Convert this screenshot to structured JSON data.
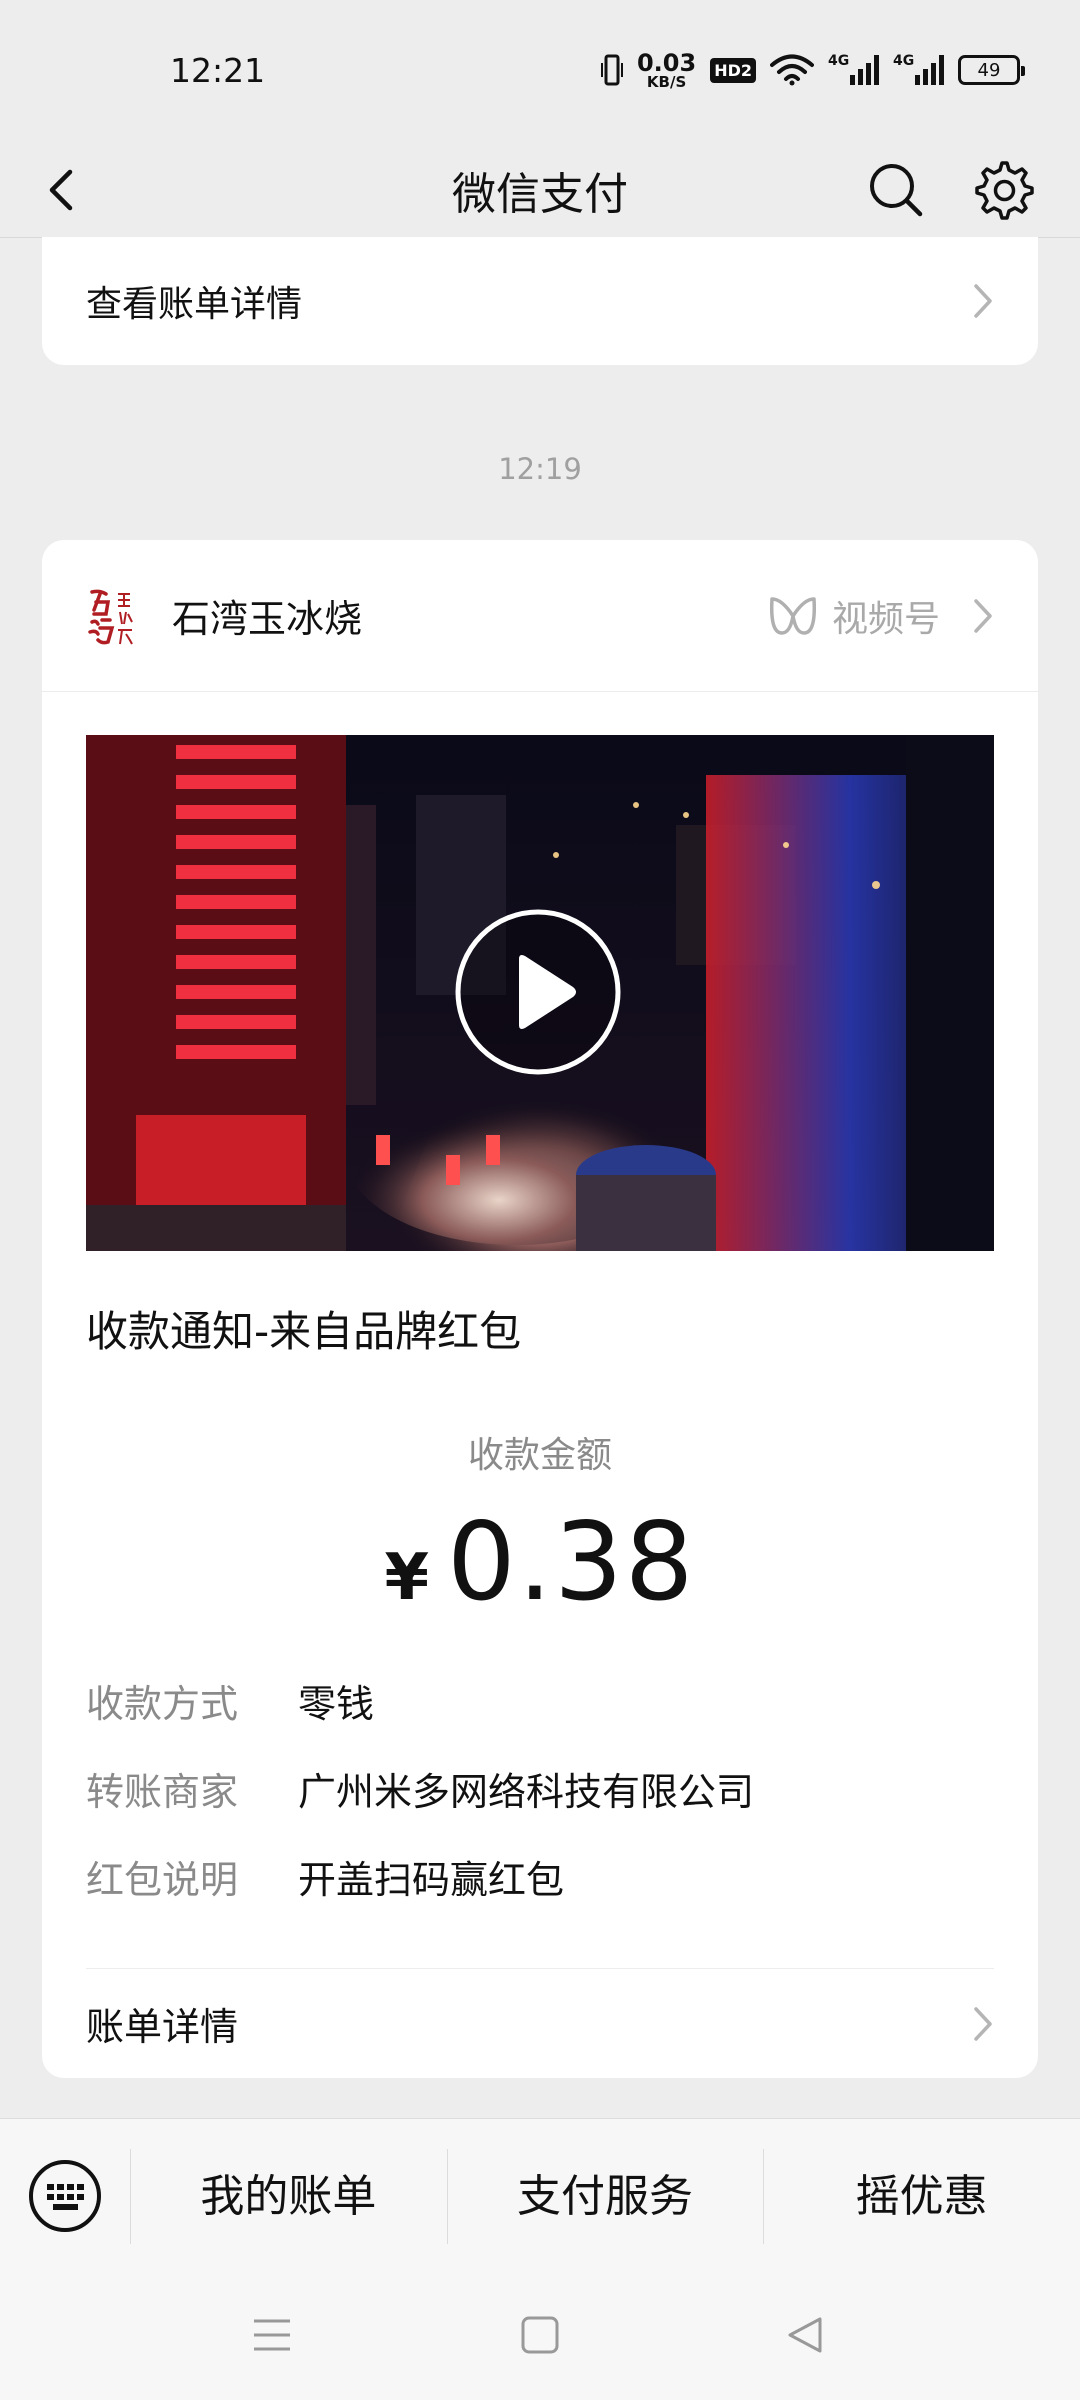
{
  "status_bar": {
    "time": "12:21",
    "net_speed_value": "0.03",
    "net_speed_unit": "KB/S",
    "hd_badge": "HD2",
    "signal_1": "4G",
    "signal_2": "4G",
    "battery": "49"
  },
  "navbar": {
    "title": "微信支付",
    "back_icon": "back-arrow-icon",
    "search_icon": "search-icon",
    "settings_icon": "gear-icon"
  },
  "bill_card": {
    "label": "查看账单详情"
  },
  "timestamp": "12:19",
  "message": {
    "brand_name": "石湾玉冰烧",
    "channel_label": "视频号",
    "title": "收款通知-来自品牌红包",
    "amount_label": "收款金额",
    "currency": "¥",
    "amount": "0.38",
    "rows": [
      {
        "key": "收款方式",
        "value": "零钱"
      },
      {
        "key": "转账商家",
        "value": "广州米多网络科技有限公司"
      },
      {
        "key": "红包说明",
        "value": "开盖扫码赢红包"
      }
    ],
    "footer_label": "账单详情"
  },
  "bottom_menu": {
    "items": [
      "我的账单",
      "支付服务",
      "摇优惠"
    ]
  },
  "colors": {
    "background": "#ededed",
    "card": "#ffffff",
    "muted_text": "#8a8a8a"
  }
}
